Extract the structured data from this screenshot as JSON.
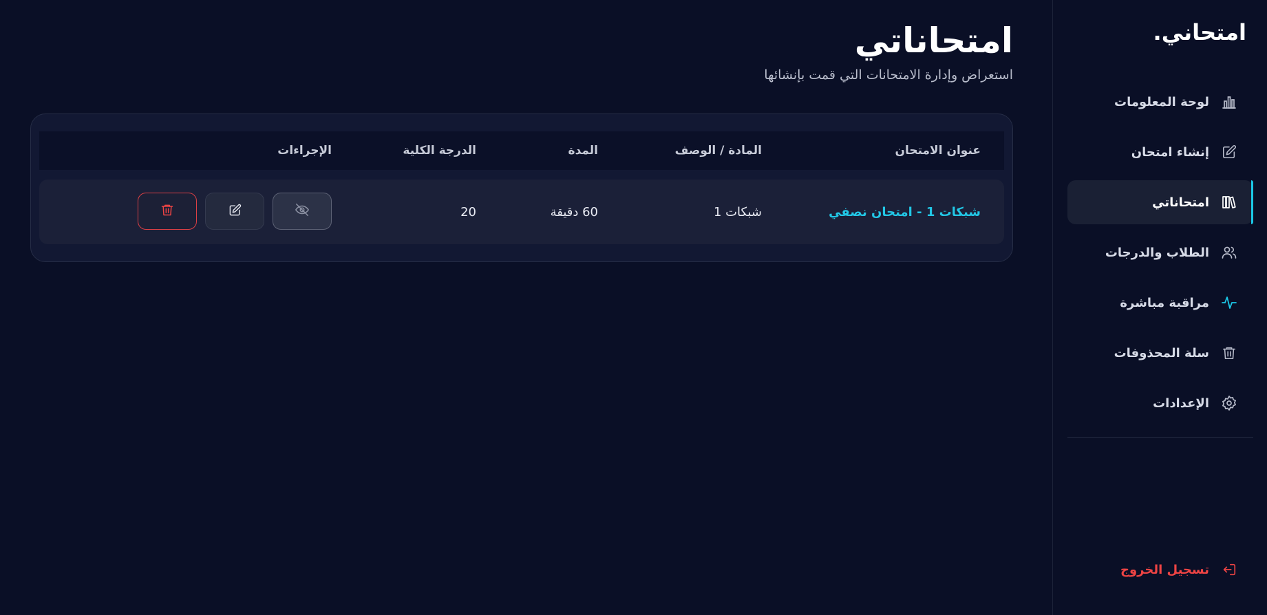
{
  "brand": {
    "name": "امتحاني",
    "dot": "."
  },
  "sidebar": {
    "items": [
      {
        "label": "لوحة المعلومات",
        "icon": "bar-chart-icon"
      },
      {
        "label": "إنشاء امتحان",
        "icon": "edit-icon"
      },
      {
        "label": "امتحاناتي",
        "icon": "library-icon",
        "active": true
      },
      {
        "label": "الطلاب والدرجات",
        "icon": "users-icon"
      },
      {
        "label": "مراقبة مباشرة",
        "icon": "activity-icon"
      },
      {
        "label": "سلة المحذوفات",
        "icon": "trash-icon"
      },
      {
        "label": "الإعدادات",
        "icon": "gear-icon"
      }
    ],
    "logout": {
      "label": "تسجيل الخروج",
      "icon": "logout-icon"
    }
  },
  "page": {
    "title": "امتحاناتي",
    "subtitle": "استعراض وإدارة الامتحانات التي قمت بإنشائها"
  },
  "table": {
    "headers": {
      "title": "عنوان الامتحان",
      "subject": "المادة / الوصف",
      "duration": "المدة",
      "total": "الدرجة الكلية",
      "actions": "الإجراءات"
    },
    "rows": [
      {
        "title": "شبكات 1 - امتحان نصفي",
        "subject": "شبكات 1",
        "duration": "60 دقيقة",
        "total": "20"
      }
    ],
    "actions": [
      "eye-off-icon",
      "edit-icon",
      "trash-icon"
    ]
  },
  "colors": {
    "background": "#0a0f26",
    "accent": "#1bc7e6",
    "danger": "#ef4444",
    "card": "#121833"
  }
}
